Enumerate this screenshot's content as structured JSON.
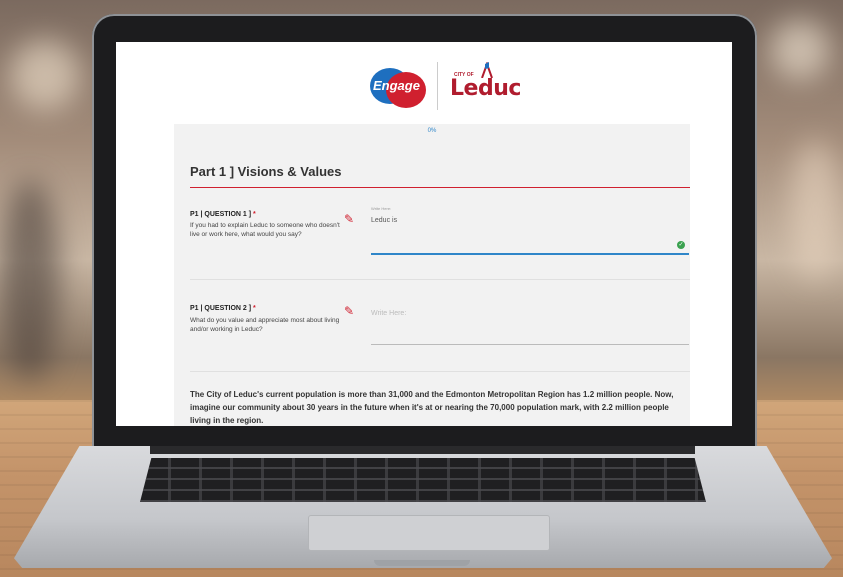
{
  "header": {
    "engage_logo": "Engage",
    "city_of": "CITY OF",
    "city_logo": "Leduc"
  },
  "progress": {
    "label": "0%",
    "value": 0
  },
  "section": {
    "title": "Part 1 ] Visions & Values"
  },
  "questions": [
    {
      "title": "P1 | QUESTION 1 ]",
      "required": "*",
      "text": "If you had to explain Leduc to someone who doesn't live or work here, what would you say?",
      "field_label": "Write Here:",
      "value": "Leduc is",
      "icon": "pencil-icon",
      "status_icon": "check-icon"
    },
    {
      "title": "P1 | QUESTION 2 ]",
      "required": "*",
      "text": "What do you value and appreciate most about living and/or working in Leduc?",
      "placeholder": "Write Here:",
      "icon": "pencil-icon"
    }
  ],
  "intro_paragraph": "The City of Leduc's current population is more than 31,000 and the Edmonton Metropolitan Region has 1.2 million people. Now, imagine our community about 30 years in the future when it's at or nearing the 70,000 population mark, with 2.2 million people living in the region.",
  "colors": {
    "accent": "#d0202f",
    "brand_blue": "#1e6fbf",
    "focus": "#2f86c9"
  }
}
